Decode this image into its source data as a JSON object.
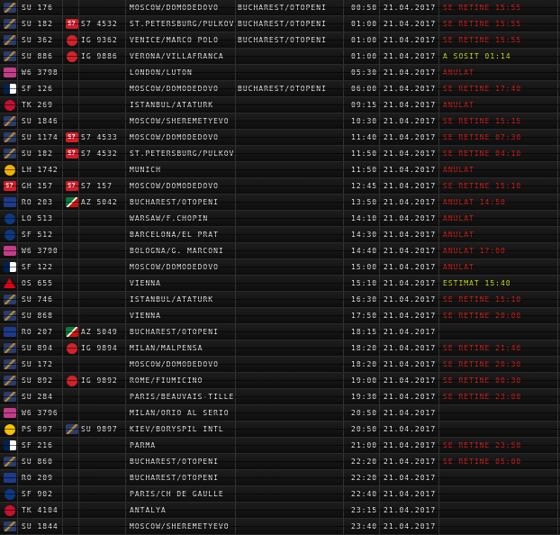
{
  "rows": [
    {
      "logo1": "aeroflot",
      "flight": "SU 176",
      "logo2": "",
      "codeshare": "",
      "from": "MOSCOW/DOMODEDOVO",
      "to": "BUCHAREST/OTOPENI",
      "time": "00:50",
      "date": "21.04.2017",
      "status": "SE RETINE 15:55",
      "status_type": "red"
    },
    {
      "logo1": "aeroflot",
      "flight": "SU 182",
      "logo2": "s7",
      "codeshare": "S7 4532",
      "from": "ST.PETERSBURG/PULKOV",
      "to": "BUCHAREST/OTOPENI",
      "time": "01:00",
      "date": "21.04.2017",
      "status": "SE RETINE 15:55",
      "status_type": "red"
    },
    {
      "logo1": "aeroflot",
      "flight": "SU 362",
      "logo2": "iberia",
      "codeshare": "IG 9362",
      "from": "VENICE/MARCO POLO",
      "to": "BUCHAREST/OTOPENI",
      "time": "01:00",
      "date": "21.04.2017",
      "status": "SE RETINE 15:55",
      "status_type": "red"
    },
    {
      "logo1": "aeroflot",
      "flight": "SU 886",
      "logo2": "iberia",
      "codeshare": "IG 9886",
      "from": "VERONA/VILLAFRANCA",
      "to": "",
      "time": "01:00",
      "date": "21.04.2017",
      "status": "A SOSIT 01:14",
      "status_type": "yellow"
    },
    {
      "logo1": "wizz",
      "flight": "W6 3798",
      "logo2": "",
      "codeshare": "",
      "from": "LONDON/LUTON",
      "to": "",
      "time": "05:30",
      "date": "21.04.2017",
      "status": "ANULAT",
      "status_type": "red"
    },
    {
      "logo1": "airfrance",
      "flight": "SF 126",
      "logo2": "",
      "codeshare": "",
      "from": "MOSCOW/DOMODEDOVO",
      "to": "BUCHAREST/OTOPENI",
      "time": "06:00",
      "date": "21.04.2017",
      "status": "SE RETINE 17:40",
      "status_type": "red"
    },
    {
      "logo1": "turkish",
      "flight": "TK 269",
      "logo2": "",
      "codeshare": "",
      "from": "ISTANBUL/ATATURK",
      "to": "",
      "time": "09:15",
      "date": "21.04.2017",
      "status": "ANULAT",
      "status_type": "red"
    },
    {
      "logo1": "aeroflot",
      "flight": "SU 1846",
      "logo2": "",
      "codeshare": "",
      "from": "MOSCOW/SHEREMETYEVO",
      "to": "",
      "time": "10:30",
      "date": "21.04.2017",
      "status": "SE RETINE 15:15",
      "status_type": "red"
    },
    {
      "logo1": "aeroflot",
      "flight": "SU 1174",
      "logo2": "s7",
      "codeshare": "S7 4533",
      "from": "MOSCOW/DOMODEDOVO",
      "to": "",
      "time": "11:40",
      "date": "21.04.2017",
      "status": "SE RETINE 07:30",
      "status_type": "red"
    },
    {
      "logo1": "aeroflot",
      "flight": "SU 182",
      "logo2": "s7",
      "codeshare": "S7 4532",
      "from": "ST.PETERSBURG/PULKOV",
      "to": "",
      "time": "11:50",
      "date": "21.04.2017",
      "status": "SE RETINE 04:10",
      "status_type": "red"
    },
    {
      "logo1": "lufthansa",
      "flight": "LH 1742",
      "logo2": "",
      "codeshare": "",
      "from": "MUNICH",
      "to": "",
      "time": "11:50",
      "date": "21.04.2017",
      "status": "ANULAT",
      "status_type": "red"
    },
    {
      "logo1": "s7",
      "flight": "GH 157",
      "logo2": "s7",
      "codeshare": "S7 157",
      "from": "MOSCOW/DOMODEDOVO",
      "to": "",
      "time": "12:45",
      "date": "21.04.2017",
      "status": "SE RETINE 15:10",
      "status_type": "red"
    },
    {
      "logo1": "tarom",
      "flight": "RO 203",
      "logo2": "alitalia",
      "codeshare": "AZ 5042",
      "from": "BUCHAREST/OTOPENI",
      "to": "",
      "time": "13:50",
      "date": "21.04.2017",
      "status": "ANULAT 14:50",
      "status_type": "red"
    },
    {
      "logo1": "lot",
      "flight": "LO 513",
      "logo2": "",
      "codeshare": "",
      "from": "WARSAW/F.CHOPIN",
      "to": "",
      "time": "14:10",
      "date": "21.04.2017",
      "status": "ANULAT",
      "status_type": "red"
    },
    {
      "logo1": "lot",
      "flight": "SF 512",
      "logo2": "",
      "codeshare": "",
      "from": "BARCELONA/EL PRAT",
      "to": "",
      "time": "14:30",
      "date": "21.04.2017",
      "status": "ANULAT",
      "status_type": "red"
    },
    {
      "logo1": "wizz",
      "flight": "W6 3790",
      "logo2": "",
      "codeshare": "",
      "from": "BOLOGNA/G. MARCONI",
      "to": "",
      "time": "14:40",
      "date": "21.04.2017",
      "status": "ANULAT 17:00",
      "status_type": "red"
    },
    {
      "logo1": "airfrance",
      "flight": "SF 122",
      "logo2": "",
      "codeshare": "",
      "from": "MOSCOW/DOMODEDOVO",
      "to": "",
      "time": "15:00",
      "date": "21.04.2017",
      "status": "ANULAT",
      "status_type": "red"
    },
    {
      "logo1": "austrian",
      "flight": "OS 655",
      "logo2": "",
      "codeshare": "",
      "from": "VIENNA",
      "to": "",
      "time": "15:10",
      "date": "21.04.2017",
      "status": "ESTIMAT 15:40",
      "status_type": "yellow"
    },
    {
      "logo1": "aeroflot",
      "flight": "SU 746",
      "logo2": "",
      "codeshare": "",
      "from": "ISTANBUL/ATATURK",
      "to": "",
      "time": "16:30",
      "date": "21.04.2017",
      "status": "SE RETINE 15:10",
      "status_type": "red"
    },
    {
      "logo1": "aeroflot",
      "flight": "SU 868",
      "logo2": "",
      "codeshare": "",
      "from": "VIENNA",
      "to": "",
      "time": "17:50",
      "date": "21.04.2017",
      "status": "SE RETINE 20:00",
      "status_type": "red"
    },
    {
      "logo1": "tarom",
      "flight": "RO 207",
      "logo2": "alitalia",
      "codeshare": "AZ 5049",
      "from": "BUCHAREST/OTOPENI",
      "to": "",
      "time": "18:15",
      "date": "21.04.2017",
      "status": "",
      "status_type": "red"
    },
    {
      "logo1": "aeroflot",
      "flight": "SU 894",
      "logo2": "iberia",
      "codeshare": "IG 9894",
      "from": "MILAN/MALPENSA",
      "to": "",
      "time": "18:20",
      "date": "21.04.2017",
      "status": "SE RETINE 21:40",
      "status_type": "red"
    },
    {
      "logo1": "aeroflot",
      "flight": "SU 172",
      "logo2": "",
      "codeshare": "",
      "from": "MOSCOW/DOMODEDOVO",
      "to": "",
      "time": "18:20",
      "date": "21.04.2017",
      "status": "SE RETINE 20:30",
      "status_type": "red"
    },
    {
      "logo1": "aeroflot",
      "flight": "SU 892",
      "logo2": "iberia",
      "codeshare": "IG 9892",
      "from": "ROME/FIUMICINO",
      "to": "",
      "time": "19:00",
      "date": "21.04.2017",
      "status": "SE RETINE 00:30",
      "status_type": "red"
    },
    {
      "logo1": "aeroflot",
      "flight": "SU 284",
      "logo2": "",
      "codeshare": "",
      "from": "PARIS/BEAUVAIS-TILLE",
      "to": "",
      "time": "19:30",
      "date": "21.04.2017",
      "status": "SE RETINE 23:00",
      "status_type": "red"
    },
    {
      "logo1": "wizz",
      "flight": "W6 3796",
      "logo2": "",
      "codeshare": "",
      "from": "MILAN/ORIO AL SERIO",
      "to": "",
      "time": "20:50",
      "date": "21.04.2017",
      "status": "",
      "status_type": "red"
    },
    {
      "logo1": "ps",
      "flight": "PS 897",
      "logo2": "aeroflot",
      "codeshare": "SU 9897",
      "from": "KIEV/BORYSPIL INTL",
      "to": "",
      "time": "20:50",
      "date": "21.04.2017",
      "status": "",
      "status_type": "red"
    },
    {
      "logo1": "airfrance",
      "flight": "SF 216",
      "logo2": "",
      "codeshare": "",
      "from": "PARMA",
      "to": "",
      "time": "21:00",
      "date": "21.04.2017",
      "status": "SE RETINE 23:50",
      "status_type": "red"
    },
    {
      "logo1": "aeroflot",
      "flight": "SU 860",
      "logo2": "",
      "codeshare": "",
      "from": "BUCHAREST/OTOPENI",
      "to": "",
      "time": "22:20",
      "date": "21.04.2017",
      "status": "SE RETINE 05:00",
      "status_type": "red"
    },
    {
      "logo1": "tarom",
      "flight": "RO 209",
      "logo2": "",
      "codeshare": "",
      "from": "BUCHAREST/OTOPENI",
      "to": "",
      "time": "22:20",
      "date": "21.04.2017",
      "status": "",
      "status_type": "red"
    },
    {
      "logo1": "lot",
      "flight": "SF 902",
      "logo2": "",
      "codeshare": "",
      "from": "PARIS/CH DE GAULLE",
      "to": "",
      "time": "22:40",
      "date": "21.04.2017",
      "status": "",
      "status_type": "red"
    },
    {
      "logo1": "turkish",
      "flight": "TK 4104",
      "logo2": "",
      "codeshare": "",
      "from": "ANTALYA",
      "to": "",
      "time": "23:15",
      "date": "21.04.2017",
      "status": "",
      "status_type": "red"
    },
    {
      "logo1": "aeroflot",
      "flight": "SU 1844",
      "logo2": "",
      "codeshare": "",
      "from": "MOSCOW/SHEREMETYEVO",
      "to": "",
      "time": "23:40",
      "date": "21.04.2017",
      "status": "",
      "status_type": "red"
    }
  ]
}
